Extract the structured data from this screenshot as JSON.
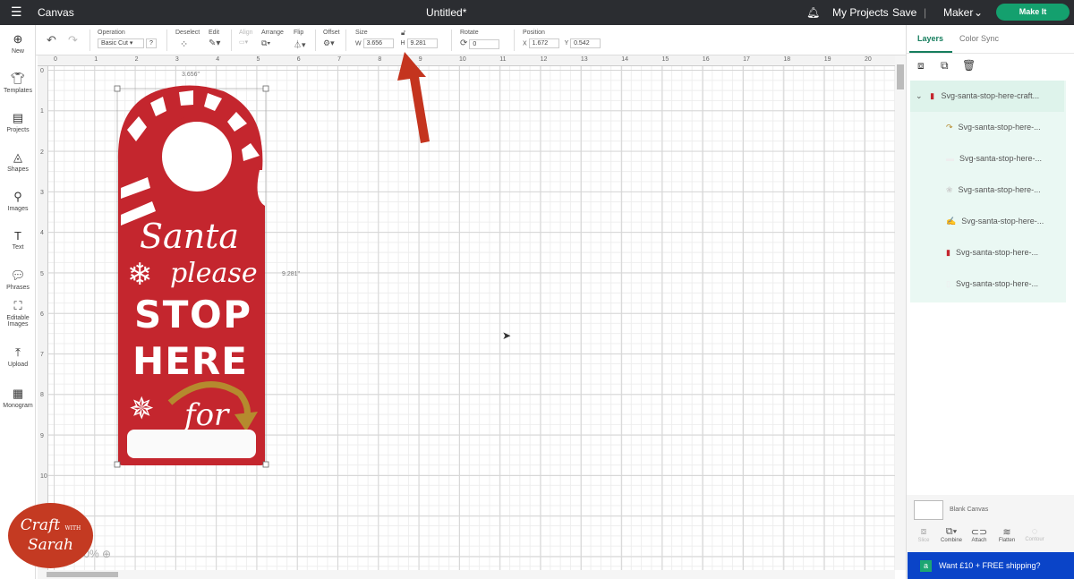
{
  "topbar": {
    "app": "Canvas",
    "title": "Untitled*",
    "my_projects": "My Projects",
    "save": "Save",
    "machine": "Maker",
    "make_it": "Make It"
  },
  "sidebar": [
    {
      "label": "New",
      "icon": "plus-icon"
    },
    {
      "label": "Templates",
      "icon": "shirt-icon"
    },
    {
      "label": "Projects",
      "icon": "projects-icon"
    },
    {
      "label": "Shapes",
      "icon": "shapes-icon"
    },
    {
      "label": "Images",
      "icon": "bulb-icon"
    },
    {
      "label": "Text",
      "icon": "text-icon"
    },
    {
      "label": "Phrases",
      "icon": "chat-icon"
    },
    {
      "label": "Editable Images",
      "icon": "edit-image-icon"
    },
    {
      "label": "Upload",
      "icon": "upload-icon"
    },
    {
      "label": "Monogram",
      "icon": "monogram-icon"
    }
  ],
  "toolbar": {
    "operation_label": "Operation",
    "operation_value": "Basic Cut",
    "help": "?",
    "deselect": "Deselect",
    "edit": "Edit",
    "align": "Align",
    "arrange": "Arrange",
    "flip": "Flip",
    "offset": "Offset",
    "size": "Size",
    "w_label": "W",
    "w": "3.656",
    "h_label": "H",
    "h": "9.281",
    "rotate": "Rotate",
    "rotate_value": "0",
    "position": "Position",
    "x_label": "X",
    "x": "1.672",
    "y_label": "Y",
    "y": "0.542"
  },
  "ruler": {
    "h": [
      "0",
      "1",
      "2",
      "3",
      "4",
      "5",
      "6",
      "7",
      "8",
      "9",
      "10",
      "11",
      "12",
      "13",
      "14",
      "15",
      "16",
      "17",
      "18",
      "19",
      "20"
    ],
    "v": [
      "0",
      "1",
      "2",
      "3",
      "4",
      "5",
      "6",
      "7",
      "8",
      "9",
      "10"
    ]
  },
  "design": {
    "width_label": "3.656\"",
    "height_label": "9.281\"",
    "line1": "Santa",
    "line2": "please",
    "line3": "STOP",
    "line4": "HERE",
    "line5": "for",
    "primary_color": "#c4262e",
    "accent_color": "#b58a2e"
  },
  "zoom": {
    "value": "100%"
  },
  "logo": {
    "text": "Craft with Sarah",
    "color": "#c43a22"
  },
  "panel": {
    "tab_layers": "Layers",
    "tab_color_sync": "Color Sync",
    "group": "Svg-santa-stop-here-craft...",
    "layers": [
      "Svg-santa-stop-here-...",
      "Svg-santa-stop-here-...",
      "Svg-santa-stop-here-...",
      "Svg-santa-stop-here-...",
      "Svg-santa-stop-here-...",
      "Svg-santa-stop-here-..."
    ],
    "blank_canvas": "Blank Canvas",
    "actions": [
      "Slice",
      "Combine",
      "Attach",
      "Flatten",
      "Contour"
    ],
    "promo": "Want £10 + FREE shipping?"
  }
}
